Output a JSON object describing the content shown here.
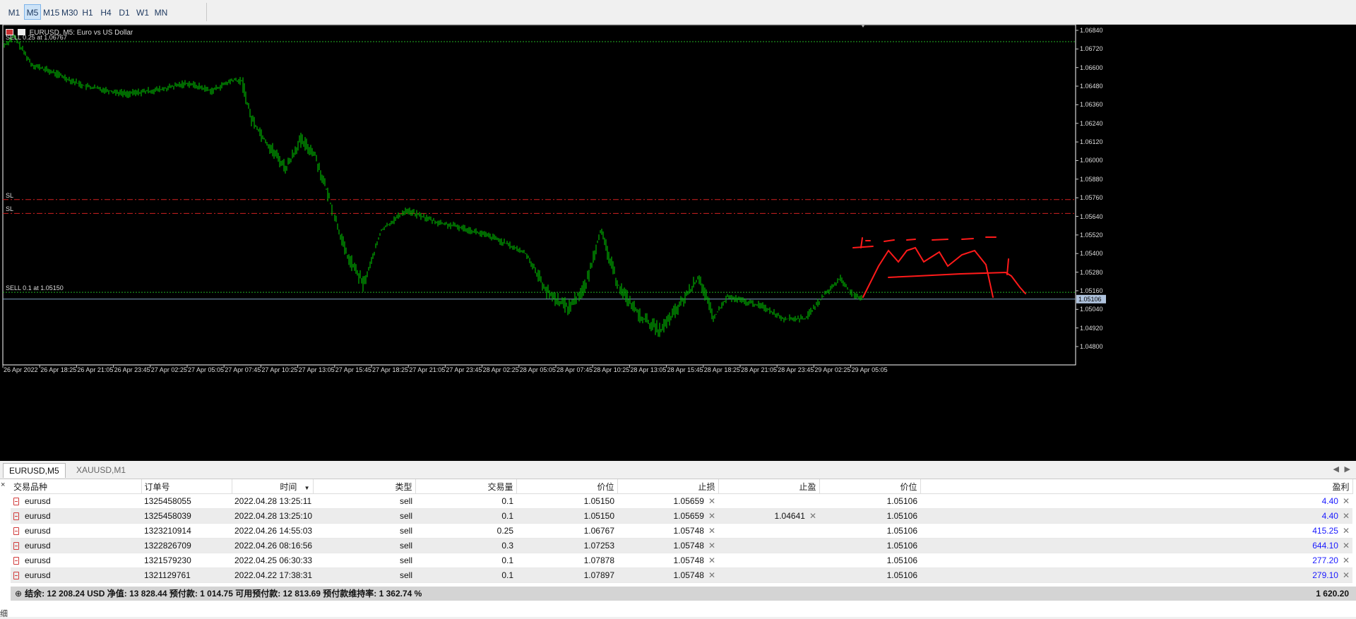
{
  "toolbar": {
    "timeframes": [
      "M1",
      "M5",
      "M15",
      "M30",
      "H1",
      "H4",
      "D1",
      "W1",
      "MN"
    ],
    "active": "M5"
  },
  "chart": {
    "title": "EURUSD, M5: Euro vs US Dollar",
    "price_labels": [
      "1.06840",
      "1.06720",
      "1.06600",
      "1.06480",
      "1.06360",
      "1.06240",
      "1.06120",
      "1.06000",
      "1.05880",
      "1.05760",
      "1.05640",
      "1.05520",
      "1.05400",
      "1.05280",
      "1.05160",
      "1.05040",
      "1.04920",
      "1.04800"
    ],
    "time_labels": [
      "26 Apr 2022",
      "26 Apr 18:25",
      "26 Apr 21:05",
      "26 Apr 23:45",
      "27 Apr 02:25",
      "27 Apr 05:05",
      "27 Apr 07:45",
      "27 Apr 10:25",
      "27 Apr 13:05",
      "27 Apr 15:45",
      "27 Apr 18:25",
      "27 Apr 21:05",
      "27 Apr 23:45",
      "28 Apr 02:25",
      "28 Apr 05:05",
      "28 Apr 07:45",
      "28 Apr 10:25",
      "28 Apr 13:05",
      "28 Apr 15:45",
      "28 Apr 18:25",
      "28 Apr 21:05",
      "28 Apr 23:45",
      "29 Apr 02:25",
      "29 Apr 05:05"
    ],
    "order_lines": [
      {
        "label": "SELL 0.25 at 1.06767",
        "price": 1.06767,
        "style": "dotted",
        "color": "#22b022"
      },
      {
        "label": "SL",
        "price": 1.05748,
        "style": "dashdot",
        "color": "#d02020"
      },
      {
        "label": "SL",
        "price": 1.05659,
        "style": "dashdot",
        "color": "#d02020"
      },
      {
        "label": "SELL 0.1 at 1.05150",
        "price": 1.0515,
        "style": "dotted",
        "color": "#22b022"
      }
    ],
    "current_price": "1.05106",
    "colors": {
      "candles": "#00b000",
      "bid_line": "#7f9fbf",
      "annotation": "#ff1a1a"
    },
    "ylim": [
      1.0474,
      1.069
    ]
  },
  "chart_tabs": {
    "active": "EURUSD,M5",
    "inactive": "XAUUSD,M1"
  },
  "trades": {
    "headers": [
      "交易品种",
      "订单号",
      "时间",
      "类型",
      "交易量",
      "价位",
      "止损",
      "止盈",
      "价位",
      "盈利"
    ],
    "rows": [
      {
        "symbol": "eurusd",
        "ticket": "1325458055",
        "time": "2022.04.28 13:25:11",
        "type": "sell",
        "volume": "0.1",
        "open": "1.05150",
        "sl": "1.05659",
        "tp": "",
        "price": "1.05106",
        "profit": "4.40"
      },
      {
        "symbol": "eurusd",
        "ticket": "1325458039",
        "time": "2022.04.28 13:25:10",
        "type": "sell",
        "volume": "0.1",
        "open": "1.05150",
        "sl": "1.05659",
        "tp": "1.04641",
        "price": "1.05106",
        "profit": "4.40"
      },
      {
        "symbol": "eurusd",
        "ticket": "1323210914",
        "time": "2022.04.26 14:55:03",
        "type": "sell",
        "volume": "0.25",
        "open": "1.06767",
        "sl": "1.05748",
        "tp": "",
        "price": "1.05106",
        "profit": "415.25"
      },
      {
        "symbol": "eurusd",
        "ticket": "1322826709",
        "time": "2022.04.26 08:16:56",
        "type": "sell",
        "volume": "0.3",
        "open": "1.07253",
        "sl": "1.05748",
        "tp": "",
        "price": "1.05106",
        "profit": "644.10"
      },
      {
        "symbol": "eurusd",
        "ticket": "1321579230",
        "time": "2022.04.25 06:30:33",
        "type": "sell",
        "volume": "0.1",
        "open": "1.07878",
        "sl": "1.05748",
        "tp": "",
        "price": "1.05106",
        "profit": "277.20"
      },
      {
        "symbol": "eurusd",
        "ticket": "1321129761",
        "time": "2022.04.22 17:38:31",
        "type": "sell",
        "volume": "0.1",
        "open": "1.07897",
        "sl": "1.05748",
        "tp": "",
        "price": "1.05106",
        "profit": "279.10"
      }
    ],
    "summary": "结余: 12 208.24 USD  净值: 13 828.44  预付款: 1 014.75  可用预付款: 12 813.69  预付款维持率: 1 362.74 %",
    "total_profit": "1 620.20"
  },
  "side_panel": {
    "close": "×",
    "label": "细"
  }
}
